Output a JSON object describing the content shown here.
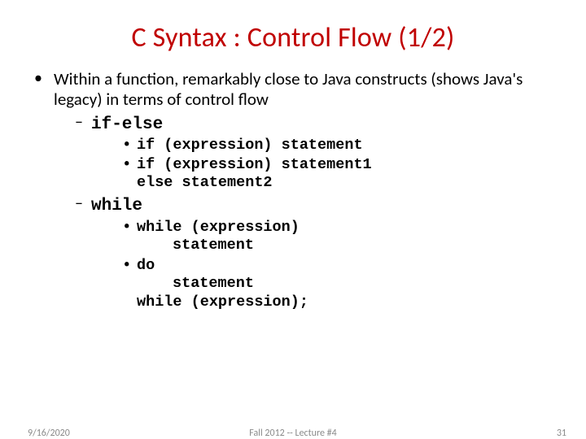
{
  "title": "C Syntax : Control Flow (1/2)",
  "bullet1": "Within a function, remarkably close to Java constructs (shows Java's legacy) in terms of control flow",
  "sec1": {
    "label": "if-else",
    "items": [
      "if (expression) statement",
      "if (expression) statement1",
      "else statement2"
    ]
  },
  "sec2": {
    "label": "while",
    "items": [
      "while (expression)",
      "statement",
      "do",
      "statement",
      "while (expression);"
    ]
  },
  "footer": {
    "date": "9/16/2020",
    "center": "Fall 2012 -- Lecture #4",
    "num": "31"
  }
}
